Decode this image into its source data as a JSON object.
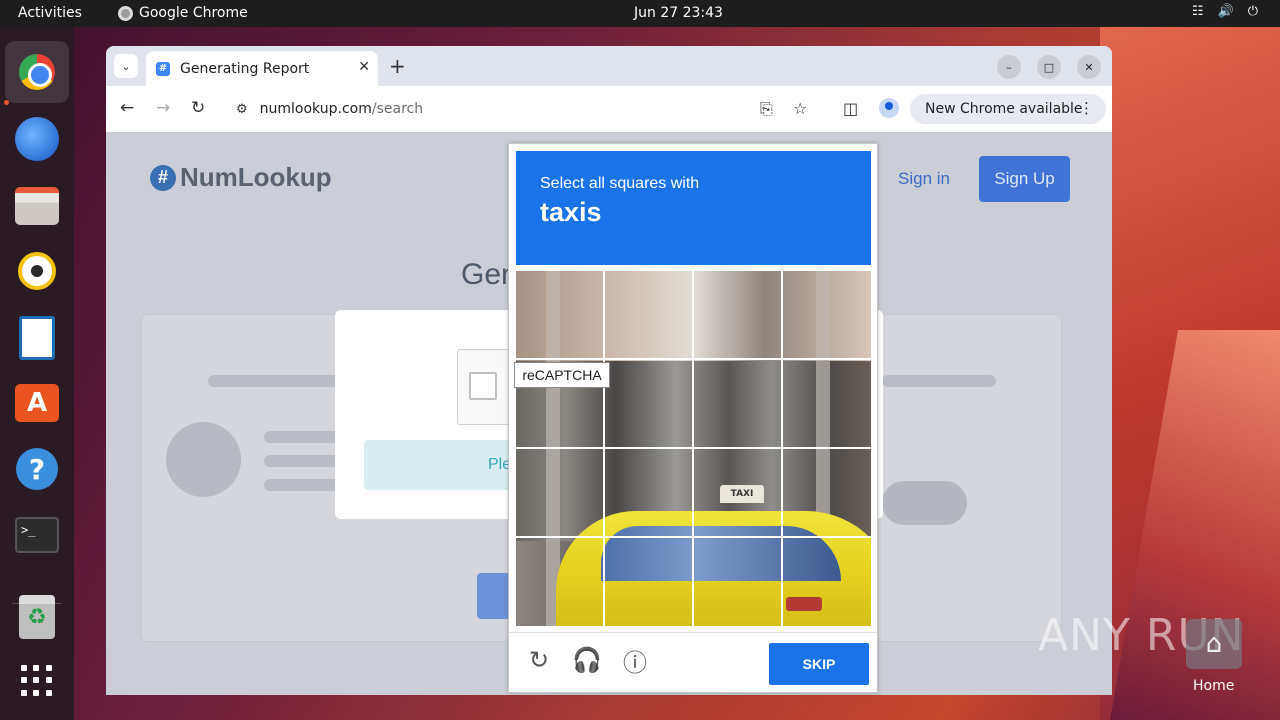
{
  "topbar": {
    "activities": "Activities",
    "app_name": "Google Chrome",
    "clock": "Jun 27  23:43",
    "tray_icons": [
      "network-icon",
      "volume-icon",
      "power-icon"
    ]
  },
  "dock": {
    "items": [
      "chrome-icon",
      "thunderbird-icon",
      "files-icon",
      "rhythmbox-icon",
      "libreoffice-writer-icon",
      "app-center-icon",
      "help-icon",
      "terminal-icon",
      "trash-icon",
      "show-apps-icon"
    ]
  },
  "browser": {
    "tab_title": "Generating Report",
    "url_host": "numlookup.com",
    "url_path": "/search",
    "update_label": "New Chrome available"
  },
  "page": {
    "logo_text": "NumLookup",
    "sign_in": "Sign in",
    "sign_up": "Sign Up",
    "heading_partial": "Gen",
    "please_partial": "Ple"
  },
  "recaptcha": {
    "tooltip": "reCAPTCHA",
    "instruction": "Select all squares with",
    "target": "taxis",
    "taxi_sign": "TAXI",
    "skip_label": "SKIP",
    "grid_size": "4x4"
  },
  "desktop": {
    "watermark": "ANY RUN",
    "home_label": "Home"
  },
  "colors": {
    "captcha_blue": "#1a73e8",
    "page_overlay": "#cbced6",
    "ubuntu_orange": "#e95420"
  }
}
